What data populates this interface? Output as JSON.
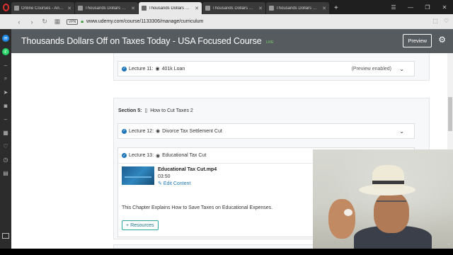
{
  "browser": {
    "tabs": [
      {
        "label": "Online Courses - Anytime",
        "active": false
      },
      {
        "label": "Thousands Dollars Off on",
        "active": false
      },
      {
        "label": "Thousands Dollars Off on",
        "active": true
      },
      {
        "label": "Thousands Dollars Off on",
        "active": false
      },
      {
        "label": "Thousands Dollars Off on",
        "active": false
      }
    ],
    "new_tab": "+",
    "vpn_label": "VPN",
    "url": "www.udemy.com/course/1133306/manage/curriculum"
  },
  "header": {
    "course_title": "Thousands Dollars Off on Taxes Today - USA Focused Course",
    "status": "LIVE",
    "preview_label": "Preview"
  },
  "curriculum": {
    "lecture_11": {
      "prefix": "Lecture 11:",
      "title": "401k Loan",
      "note": "(Preview enabled)"
    },
    "section_5": {
      "prefix": "Section 5:",
      "title": "How to Cut Taxes 2"
    },
    "lecture_12": {
      "prefix": "Lecture 12:",
      "title": "Divorce Tax Settlement Cut"
    },
    "lecture_13": {
      "prefix": "Lecture 13:",
      "title": "Educational Tax Cut",
      "file_name": "Educational Tax Cut.mp4",
      "duration": "03:50",
      "edit_label": "Edit Content",
      "description": "This Chapter Explains How to Save Taxes on Educational Expenses.",
      "resources_label": "Resources"
    }
  },
  "colors": {
    "header_bg": "#565b60",
    "accent_blue": "#1e77b8",
    "live_green": "#7fd36b"
  }
}
